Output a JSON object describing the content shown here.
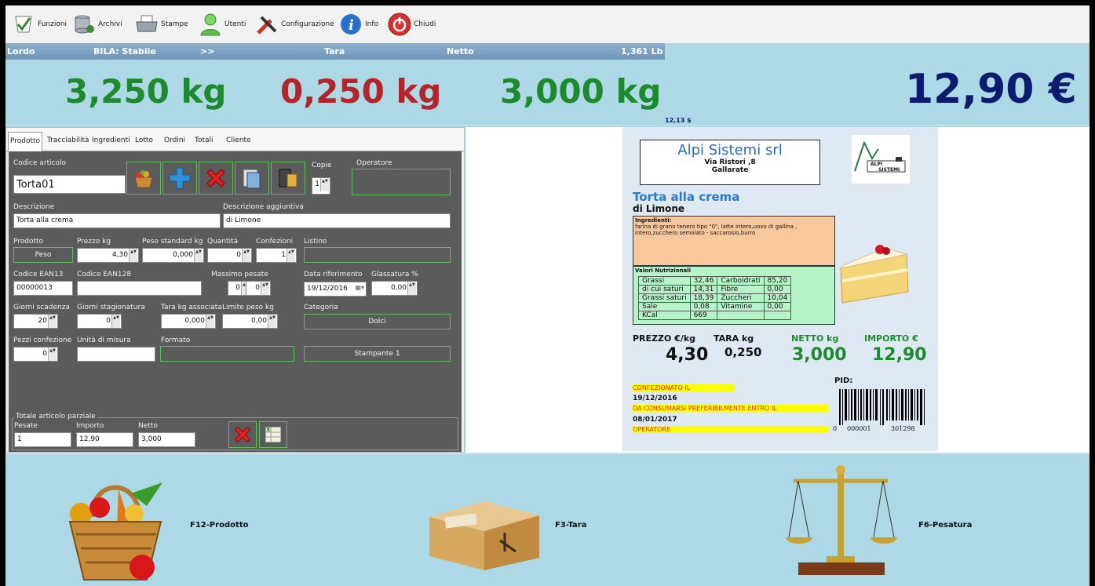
{
  "toolbar": {
    "items": [
      {
        "label": "Funzioni"
      },
      {
        "label": "Archivi"
      },
      {
        "label": "Stampe"
      },
      {
        "label": "Utenti"
      },
      {
        "label": "Configurazione"
      },
      {
        "label": "Info"
      },
      {
        "label": "Chiudi"
      }
    ]
  },
  "infobar": {
    "lordo": "Lordo",
    "bila": "BILA: Stabile",
    "arrows": ">>",
    "tara": "Tara",
    "netto": "Netto",
    "lb": "1,361 Lb"
  },
  "big": {
    "lordo": "3,250 kg",
    "tara": "0,250 kg",
    "netto": "3,000 kg",
    "price": "12,90 €",
    "usd": "12,13 $"
  },
  "colors": {
    "green": "#1e8a2e",
    "red": "#b3242b",
    "navy": "#0d1b6e"
  },
  "tabs": [
    "Prodotto",
    "Tracciabilità",
    "Ingredienti",
    "Lotto",
    "Ordini",
    "Totali",
    "Cliente"
  ],
  "form": {
    "codice_articolo_label": "Codice articolo",
    "codice_articolo": "Torta01",
    "copie_label": "Copie",
    "copie": "1",
    "operatore_label": "Operatore",
    "descrizione_label": "Descrizione",
    "descrizione": "Torta alla crema",
    "descr_agg_label": "Descrizione aggiuntiva",
    "descr_agg": "di Limone",
    "prodotto_label": "Prodotto",
    "prodotto": "Peso",
    "prezzo_label": "Prezzo kg",
    "prezzo": "4,30",
    "peso_std_label": "Peso standard kg",
    "peso_std": "0,000",
    "quantita_label": "Quantità",
    "quantita": "0",
    "confezioni_label": "Confezioni",
    "confezioni": "1",
    "listino_label": "Listino",
    "ean13_label": "Codice EAN13",
    "ean13": "00000013",
    "ean128_label": "Codice EAN128",
    "max_pesate_label": "Massimo pesate",
    "max1": "0",
    "max2": "0",
    "data_rif_label": "Data riferimento",
    "data_rif": "19/12/2016",
    "glassatura_label": "Glassatura %",
    "glassatura": "0,00",
    "giorni_scad_label": "Giorni scadenza",
    "giorni_scad": "20",
    "giorni_stag_label": "Giorni stagionatura",
    "giorni_stag": "0",
    "tara_assoc_label": "Tara kg associata",
    "tara_assoc": "0,000",
    "limite_label": "Limite peso kg",
    "limite": "0,00",
    "categoria_label": "Categoria",
    "categoria": "Dolci",
    "pezzi_label": "Pezzi confezione",
    "pezzi": "0",
    "unita_label": "Unità di misura",
    "formato_label": "Formato",
    "stampante": "Stampante 1",
    "partial_title": "Totale articolo parziale",
    "pesate_label": "Pesate",
    "pesate": "1",
    "importo_label": "Importo",
    "importo": "12,90",
    "netto_label": "Netto",
    "netto": "3,000"
  },
  "label": {
    "company": "Alpi Sistemi srl",
    "street": "Via Ristori ,8",
    "city": "Gallarate",
    "logo_text": "ALPI SISTEMI",
    "product": "Torta alla crema",
    "product2": "di Limone",
    "ingredienti_title": "Ingredienti:",
    "ingredienti_text": "farina di grano tenero tipo \"0\", latte intero,uovo di gallina , intero,zucchero semolato - saccarosio,burro",
    "valori_title": "Valori Nutrizionali",
    "nutrition": [
      [
        "Grassi",
        "32,46",
        "Carboidrati",
        "85,20"
      ],
      [
        "di cui saturi",
        "14,31",
        "Fibre",
        "0,00"
      ],
      [
        "Grassi saturi",
        "18,39",
        "Zuccheri",
        "10,04"
      ],
      [
        "Sale",
        "0,08",
        "Vitamine",
        "0,00"
      ],
      [
        "KCal",
        "669",
        "",
        ""
      ]
    ],
    "prezzo_h": "PREZZO €/kg",
    "tara_h": "TARA kg",
    "netto_h": "NETTO kg",
    "importo_h": "IMPORTO €",
    "prezzo": "4,30",
    "tara": "0,250",
    "netto": "3,000",
    "importo": "12,90",
    "pid": "PID:",
    "confezionato": "CONFEZIONATO IL",
    "date1": "19/12/2016",
    "consumarsi": "DA CONSUMARSI PREFERIBILMENTE ENTRO IL",
    "date2": "08/01/2017",
    "operatore": "OPERATORE",
    "barcode_a": "0",
    "barcode_b": "000001",
    "barcode_c": "301298"
  },
  "bottom": {
    "prodotto": "F12-Prodotto",
    "tara": "F3-Tara",
    "pesatura": "F6-Pesatura"
  }
}
